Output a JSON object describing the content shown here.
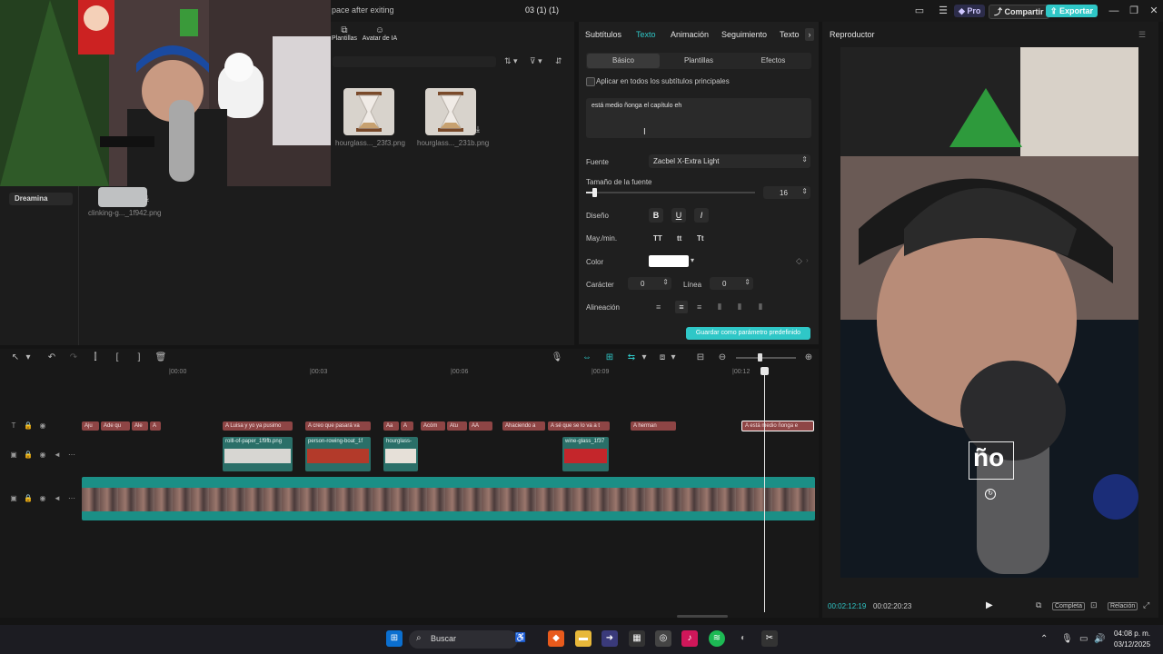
{
  "window": {
    "project_title": "03 (1) (1)",
    "hint_text": "pace after exiting",
    "pro_label": "Pro",
    "share_label": "Compartir",
    "export_label": "Exportar"
  },
  "media_tabs": {
    "templates_label": "Plantillas",
    "ai_avatar_label": "Avatar de IA"
  },
  "side": {
    "dreamina_label": "Dreamina"
  },
  "media": {
    "items": [
      {
        "caption": "hourglass..._23f3.png"
      },
      {
        "caption": "hourglass..._231b.png"
      },
      {
        "caption": "clinking-g..._1f942.png"
      }
    ]
  },
  "inspector": {
    "tabs": [
      "Subtítulos",
      "Texto",
      "Animación",
      "Seguimiento",
      "Texto"
    ],
    "subtabs": [
      "Básico",
      "Plantillas",
      "Efectos"
    ],
    "apply_all_label": "Aplicar en todos los subtítulos principales",
    "text_content": "está medio ñonga el capítulo eh",
    "font_label": "Fuente",
    "font_value": "Zacbel X-Extra Light",
    "size_label": "Tamaño de la fuente",
    "size_value": "16",
    "size_level": 0.04,
    "design_label": "Diseño",
    "case_label": "May./min.",
    "case_options": [
      "TT",
      "tt",
      "Tt"
    ],
    "color_label": "Color",
    "color_value": "#ffffff",
    "char_label": "Carácter",
    "char_value": "0",
    "line_label": "Línea",
    "line_value": "0",
    "align_label": "Alineación",
    "save_default_label": "Guardar como parámetro predefinido"
  },
  "player": {
    "title": "Reproductor",
    "subtitle_overlay": "ño",
    "current_time": "00:02:12:19",
    "total_time": "00:02:20:23",
    "full_label": "Completa",
    "ratio_label": "Relación"
  },
  "timeline": {
    "ticks": [
      "|00:00",
      "|00:03",
      "|00:06",
      "|00:09",
      "|00:12"
    ],
    "text_clips": [
      "ju",
      "de qu",
      "le",
      "",
      "Luisa y yo ya pusimo",
      "creo que pasará va",
      "a",
      "",
      "cóm",
      "tu",
      "A",
      "haciendo a",
      "sé que se lo va a t",
      "herman",
      "está medio ñonga e"
    ],
    "overlay_clips": [
      "rolll-of-paper_1f9fb.png",
      "person-rowing-boat_1f",
      "hourglass-",
      "wine-glass_1f37"
    ]
  },
  "taskbar": {
    "search_label": "Buscar",
    "time": "04:08 p. m.",
    "date": "03/12/2025"
  },
  "colors": {
    "accent": "#2fc7c7",
    "clip_text": "#b55a5a",
    "track_main": "#1b8f86"
  }
}
